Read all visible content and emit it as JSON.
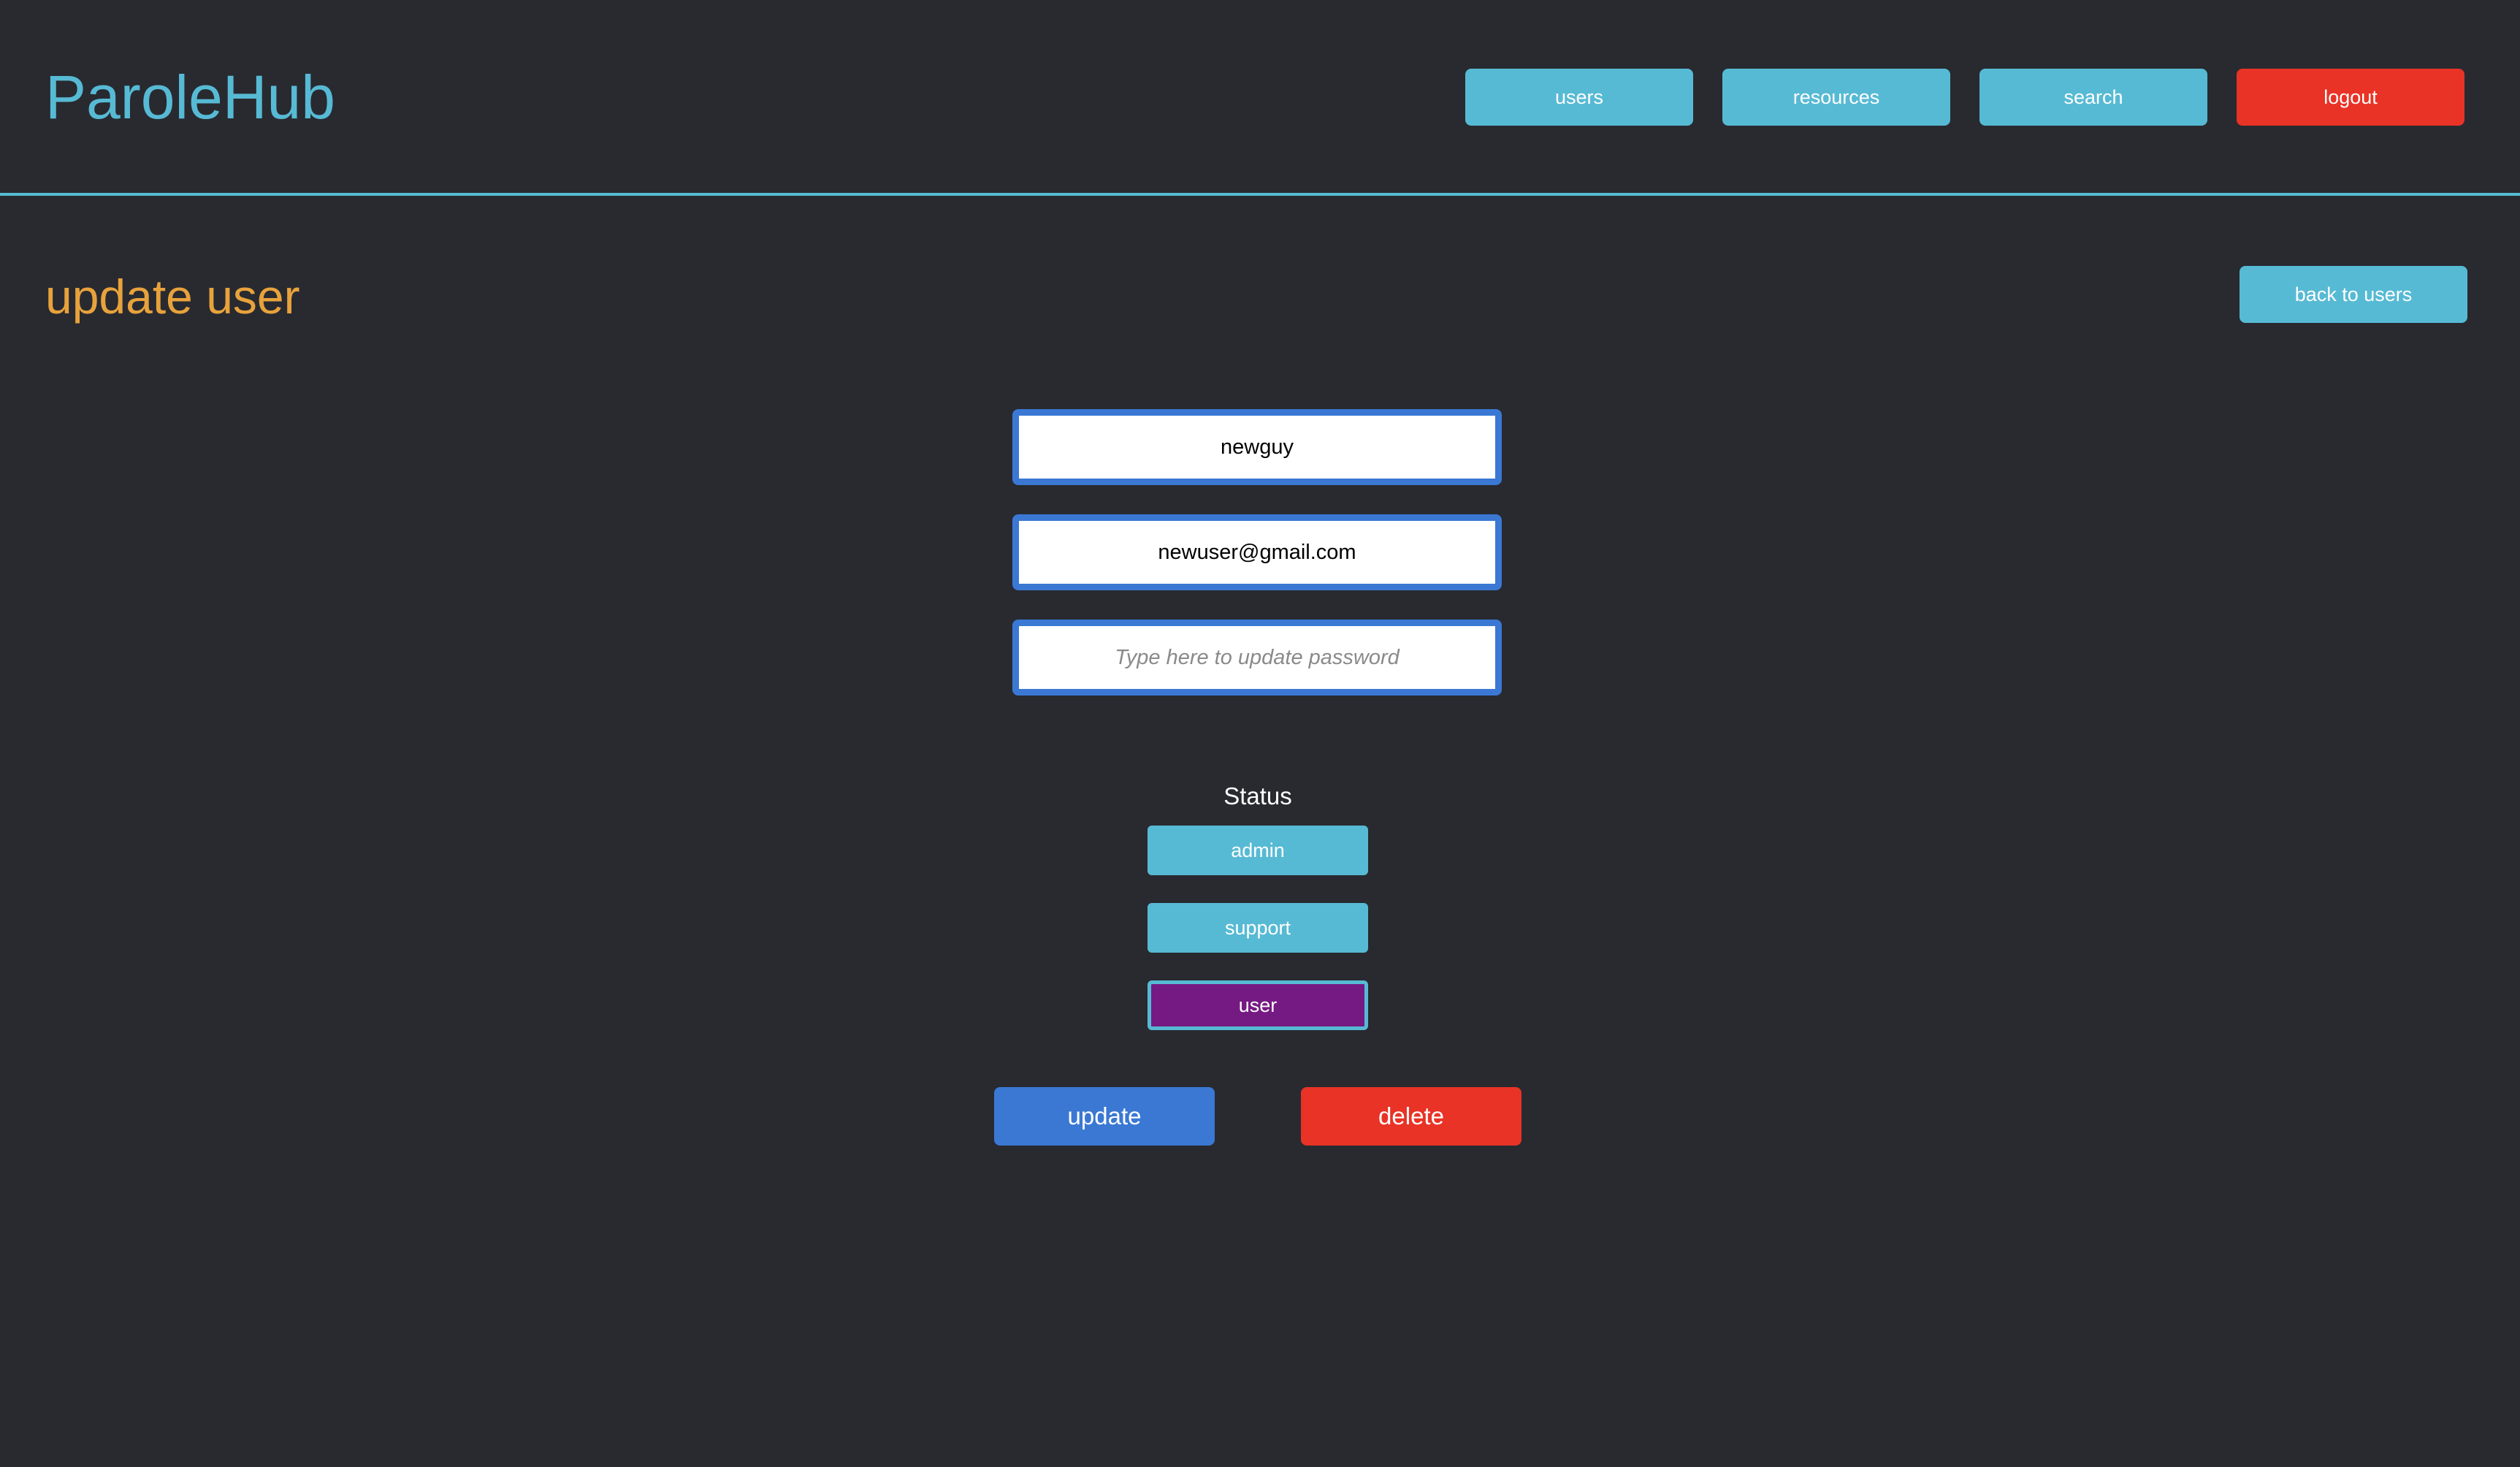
{
  "app": {
    "name": "ParoleHub"
  },
  "nav": {
    "users": "users",
    "resources": "resources",
    "search": "search",
    "logout": "logout"
  },
  "page": {
    "title": "update user",
    "back_label": "back to users"
  },
  "form": {
    "username_value": "newguy",
    "email_value": "newuser@gmail.com",
    "password_value": "",
    "password_placeholder": "Type here to update password"
  },
  "status": {
    "label": "Status",
    "options": [
      "admin",
      "support",
      "user"
    ],
    "selected": "user"
  },
  "actions": {
    "update_label": "update",
    "delete_label": "delete"
  },
  "colors": {
    "background": "#282a30",
    "accent": "#57bad4",
    "title": "#e8a23c",
    "primary": "#3a78d4",
    "danger": "#e83326",
    "selected": "#761a83"
  }
}
